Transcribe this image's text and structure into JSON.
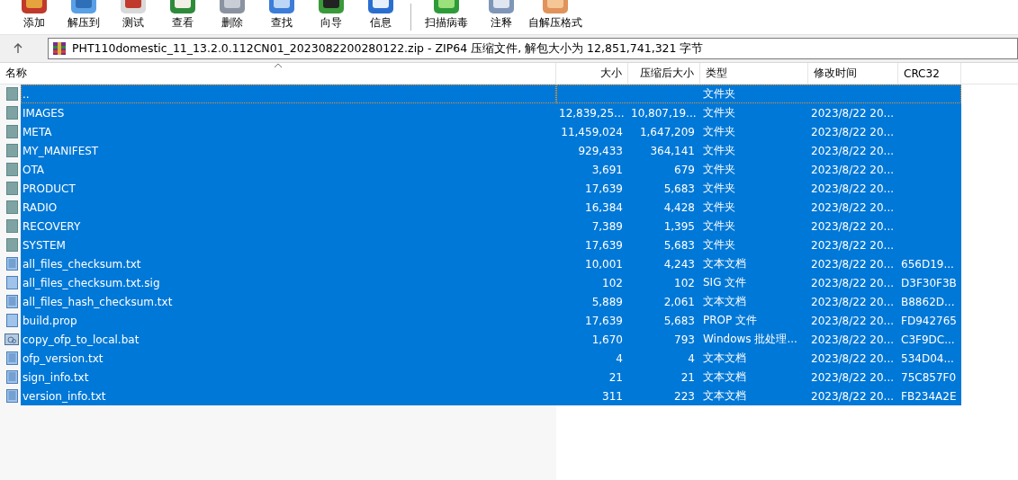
{
  "toolbar": [
    [
      {
        "label": "添加",
        "kind": "add"
      },
      {
        "label": "解压到",
        "kind": "extract"
      },
      {
        "label": "测试",
        "kind": "test"
      },
      {
        "label": "查看",
        "kind": "view"
      },
      {
        "label": "删除",
        "kind": "delete"
      },
      {
        "label": "查找",
        "kind": "find"
      },
      {
        "label": "向导",
        "kind": "wizard"
      },
      {
        "label": "信息",
        "kind": "info"
      }
    ],
    [
      {
        "label": "扫描病毒",
        "kind": "scan"
      },
      {
        "label": "注释",
        "kind": "comment"
      },
      {
        "label": "自解压格式",
        "kind": "sfx"
      }
    ]
  ],
  "address": {
    "text": "PHT110domestic_11_13.2.0.112CN01_2023082200280122.zip - ZIP64 压缩文件, 解包大小为 12,851,741,321 字节"
  },
  "table": {
    "columns": [
      {
        "label": "名称",
        "sorted": true
      },
      {
        "label": "大小",
        "sorted": false
      },
      {
        "label": "压缩后大小",
        "sorted": false
      },
      {
        "label": "类型",
        "sorted": false
      },
      {
        "label": "修改时间",
        "sorted": false
      },
      {
        "label": "CRC32",
        "sorted": false
      }
    ],
    "rows": [
      {
        "kind": "folder",
        "selected": true,
        "focused": true,
        "cells": [
          "..",
          "",
          "",
          "文件夹",
          "",
          ""
        ]
      },
      {
        "kind": "folder",
        "selected": true,
        "focused": false,
        "cells": [
          "IMAGES",
          "12,839,25...",
          "10,807,19...",
          "文件夹",
          "2023/8/22 20...",
          ""
        ]
      },
      {
        "kind": "folder",
        "selected": true,
        "focused": false,
        "cells": [
          "META",
          "11,459,024",
          "1,647,209",
          "文件夹",
          "2023/8/22 20...",
          ""
        ]
      },
      {
        "kind": "folder",
        "selected": true,
        "focused": false,
        "cells": [
          "MY_MANIFEST",
          "929,433",
          "364,141",
          "文件夹",
          "2023/8/22 20...",
          ""
        ]
      },
      {
        "kind": "folder",
        "selected": true,
        "focused": false,
        "cells": [
          "OTA",
          "3,691",
          "679",
          "文件夹",
          "2023/8/22 20...",
          ""
        ]
      },
      {
        "kind": "folder",
        "selected": true,
        "focused": false,
        "cells": [
          "PRODUCT",
          "17,639",
          "5,683",
          "文件夹",
          "2023/8/22 20...",
          ""
        ]
      },
      {
        "kind": "folder",
        "selected": true,
        "focused": false,
        "cells": [
          "RADIO",
          "16,384",
          "4,428",
          "文件夹",
          "2023/8/22 20...",
          ""
        ]
      },
      {
        "kind": "folder",
        "selected": true,
        "focused": false,
        "cells": [
          "RECOVERY",
          "7,389",
          "1,395",
          "文件夹",
          "2023/8/22 20...",
          ""
        ]
      },
      {
        "kind": "folder",
        "selected": true,
        "focused": false,
        "cells": [
          "SYSTEM",
          "17,639",
          "5,683",
          "文件夹",
          "2023/8/22 20...",
          ""
        ]
      },
      {
        "kind": "text",
        "selected": true,
        "focused": false,
        "cells": [
          "all_files_checksum.txt",
          "10,001",
          "4,243",
          "文本文档",
          "2023/8/22 20...",
          "656D19..."
        ]
      },
      {
        "kind": "blank",
        "selected": true,
        "focused": false,
        "cells": [
          "all_files_checksum.txt.sig",
          "102",
          "102",
          "SIG 文件",
          "2023/8/22 20...",
          "D3F30F3B"
        ]
      },
      {
        "kind": "text",
        "selected": true,
        "focused": false,
        "cells": [
          "all_files_hash_checksum.txt",
          "5,889",
          "2,061",
          "文本文档",
          "2023/8/22 20...",
          "B8862D..."
        ]
      },
      {
        "kind": "blank",
        "selected": true,
        "focused": false,
        "cells": [
          "build.prop",
          "17,639",
          "5,683",
          "PROP 文件",
          "2023/8/22 20...",
          "FD942765"
        ]
      },
      {
        "kind": "batch",
        "selected": true,
        "focused": false,
        "cells": [
          "copy_ofp_to_local.bat",
          "1,670",
          "793",
          "Windows 批处理...",
          "2023/8/22 20...",
          "C3F9DC..."
        ]
      },
      {
        "kind": "text",
        "selected": true,
        "focused": false,
        "cells": [
          "ofp_version.txt",
          "4",
          "4",
          "文本文档",
          "2023/8/22 20...",
          "534D04..."
        ]
      },
      {
        "kind": "text",
        "selected": true,
        "focused": false,
        "cells": [
          "sign_info.txt",
          "21",
          "21",
          "文本文档",
          "2023/8/22 20...",
          "75C857F0"
        ]
      },
      {
        "kind": "text",
        "selected": true,
        "focused": false,
        "cells": [
          "version_info.txt",
          "311",
          "223",
          "文本文档",
          "2023/8/22 20...",
          "FB234A2E"
        ]
      }
    ]
  }
}
